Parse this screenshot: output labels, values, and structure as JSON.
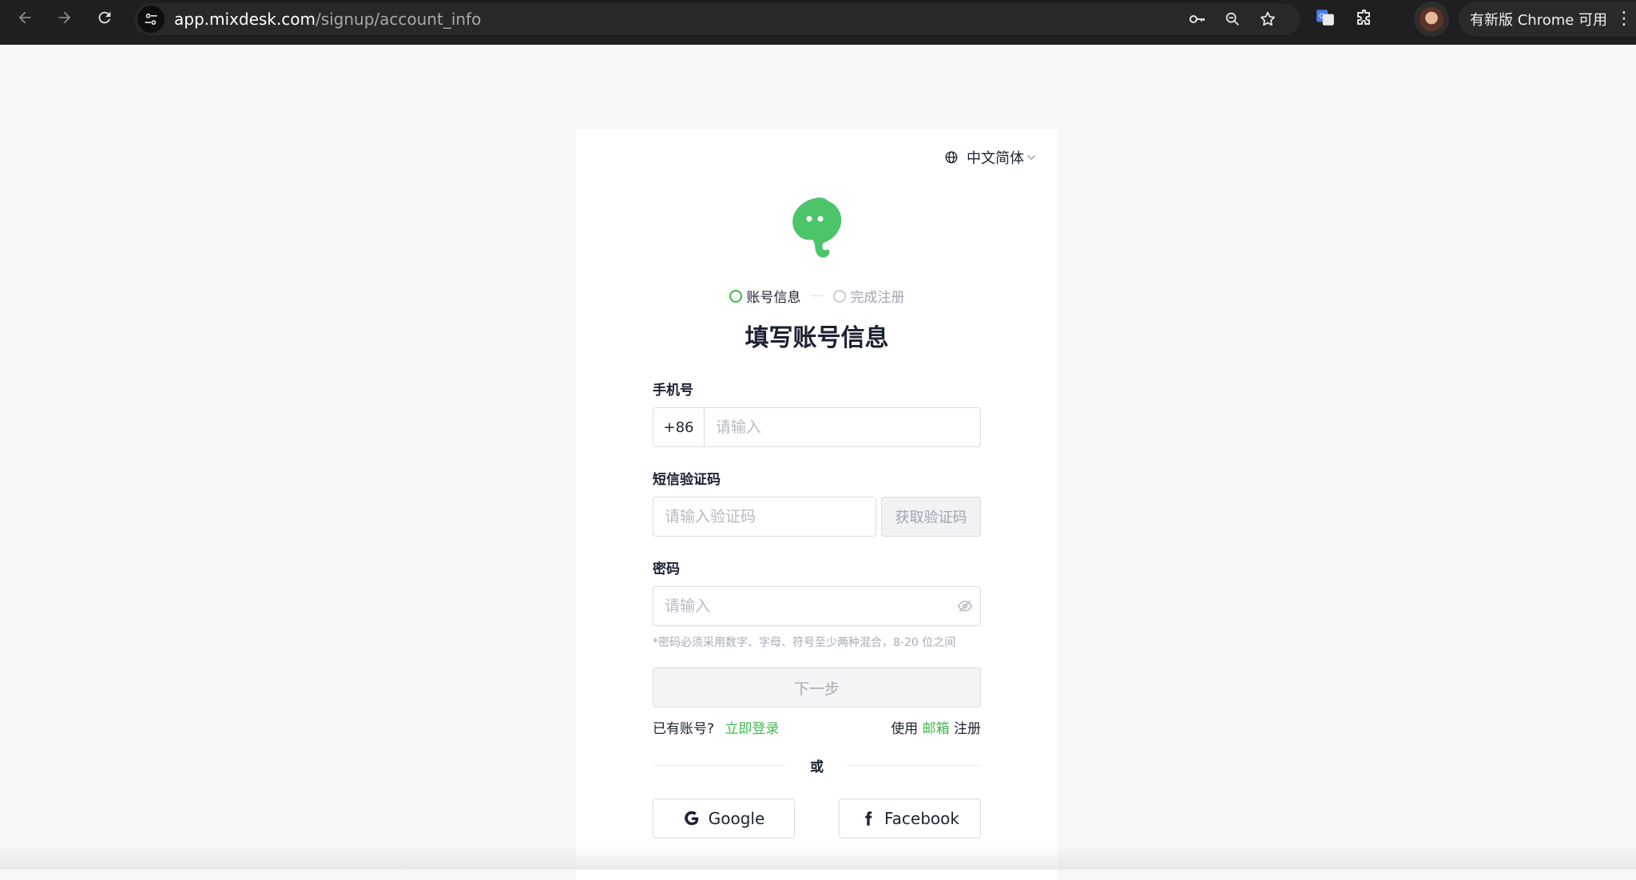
{
  "browser": {
    "url_domain": "app.mixdesk.com",
    "url_path": "/signup/account_info",
    "update_label": "有新版 Chrome 可用"
  },
  "lang": {
    "label": "中文简体"
  },
  "steps": [
    {
      "label": "账号信息",
      "state": "active"
    },
    {
      "label": "完成注册",
      "state": "inactive"
    }
  ],
  "title": "填写账号信息",
  "form": {
    "phone": {
      "label": "手机号",
      "prefix": "+86",
      "placeholder": "请输入",
      "value": ""
    },
    "sms": {
      "label": "短信验证码",
      "placeholder": "请输入验证码",
      "value": "",
      "button": "获取验证码"
    },
    "password": {
      "label": "密码",
      "placeholder": "请输入",
      "value": "",
      "hint": "*密码必须采用数字、字母、符号至少两种混合，8-20 位之间"
    },
    "next_button": "下一步"
  },
  "links": {
    "has_account": "已有账号?",
    "login_now": "立即登录",
    "use": "使用",
    "email": "邮箱",
    "register": "注册"
  },
  "or_label": "或",
  "social": {
    "google": "Google",
    "facebook": "Facebook"
  },
  "colors": {
    "accent": "#3fb950",
    "text": "#1c2233",
    "border": "#d9dce2"
  }
}
